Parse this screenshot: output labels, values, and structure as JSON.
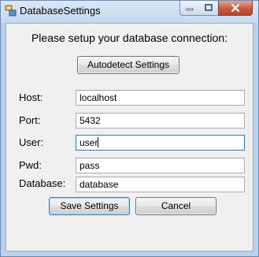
{
  "window": {
    "title": "DatabaseSettings",
    "icon": "database-app-icon",
    "controls": [
      "minimize-icon",
      "maximize-icon",
      "close-icon"
    ]
  },
  "form": {
    "heading": "Please setup your database connection:",
    "autodetect_label": "Autodetect Settings",
    "fields": {
      "host": {
        "label": "Host:",
        "value": "localhost"
      },
      "port": {
        "label": "Port:",
        "value": "5432"
      },
      "user": {
        "label": "User:",
        "value": "user"
      },
      "pwd": {
        "label": "Pwd:",
        "value": "pass"
      },
      "database": {
        "label": "Database:",
        "value": "database"
      }
    },
    "save_label": "Save Settings",
    "cancel_label": "Cancel"
  }
}
